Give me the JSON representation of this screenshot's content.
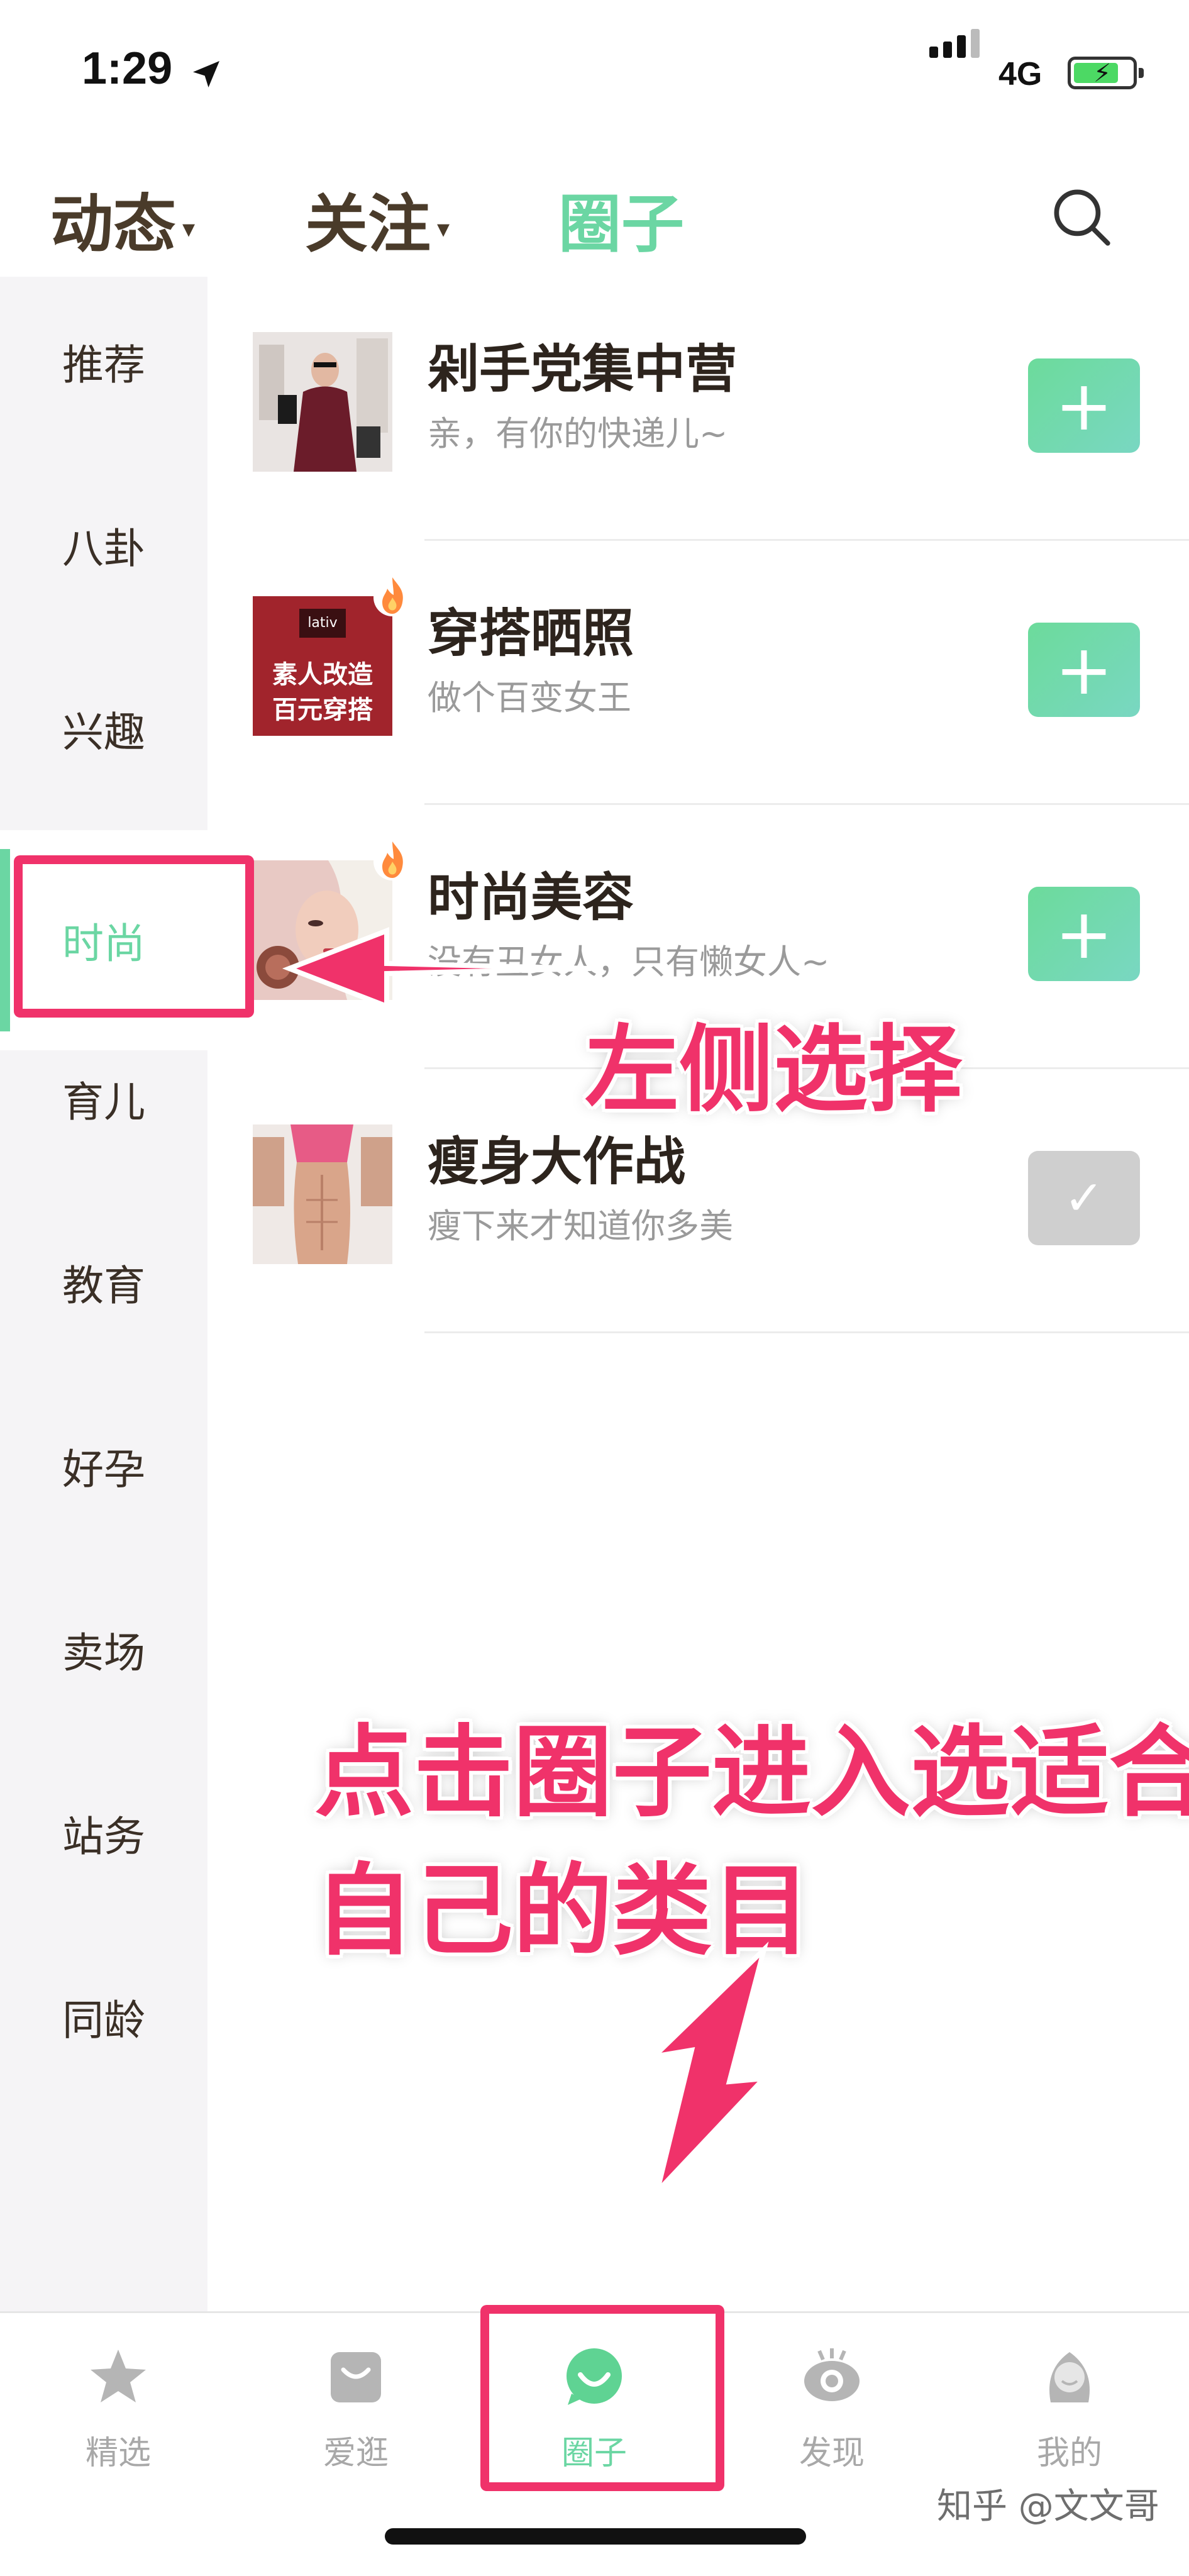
{
  "status_bar": {
    "time": "1:29",
    "network": "4G",
    "location_icon": "location-arrow-icon",
    "signal_icon": "cellular-signal-icon",
    "battery_icon": "battery-charging-icon",
    "battery_color": "#4cd964"
  },
  "top_tabs": {
    "items": [
      {
        "label": "动态",
        "caret": "▾",
        "active": false
      },
      {
        "label": "关注",
        "caret": "▾",
        "active": false
      },
      {
        "label": "圈子",
        "caret": "",
        "active": true
      }
    ],
    "search_icon": "search-icon",
    "accent_color": "#6bd6a3"
  },
  "sidebar": {
    "items": [
      {
        "label": "推荐"
      },
      {
        "label": "八卦"
      },
      {
        "label": "兴趣"
      },
      {
        "label": "时尚",
        "active": true
      },
      {
        "label": "育儿"
      },
      {
        "label": "教育"
      },
      {
        "label": "好孕"
      },
      {
        "label": "卖场"
      },
      {
        "label": "站务"
      },
      {
        "label": "同龄"
      }
    ]
  },
  "groups": [
    {
      "name": "剁手党集中营",
      "desc": "亲，有你的快递儿~",
      "button": "+",
      "joined": false,
      "hot": false,
      "thumb_icon": "shopping-woman-photo"
    },
    {
      "name": "穿搭晒照",
      "desc": "做个百变女王",
      "button": "+",
      "joined": false,
      "hot": true,
      "thumb_icon": "lativ-poster",
      "thumb_brand": "lativ",
      "thumb_line1": "素人改造",
      "thumb_line2": "百元穿搭"
    },
    {
      "name": "时尚美容",
      "desc": "没有丑女人，只有懒女人~",
      "button": "+",
      "joined": false,
      "hot": true,
      "thumb_icon": "makeup-woman-photo"
    },
    {
      "name": "瘦身大作战",
      "desc": "瘦下来才知道你多美",
      "button": "✓",
      "joined": true,
      "hot": false,
      "thumb_icon": "fitness-woman-photo"
    }
  ],
  "annotations": {
    "left_select": "左侧选择",
    "click_circle_line1": "点击圈子进入选适合",
    "click_circle_line2": "自己的类目",
    "color": "#f0326a"
  },
  "bottom_tabs": [
    {
      "label": "精选",
      "icon": "star-icon",
      "active": false
    },
    {
      "label": "爱逛",
      "icon": "shopping-bag-icon",
      "active": false
    },
    {
      "label": "圈子",
      "icon": "chat-bubble-smile-icon",
      "active": true
    },
    {
      "label": "发现",
      "icon": "eye-icon",
      "active": false
    },
    {
      "label": "我的",
      "icon": "profile-girl-icon",
      "active": false
    }
  ],
  "watermark": "知乎 @文文哥"
}
